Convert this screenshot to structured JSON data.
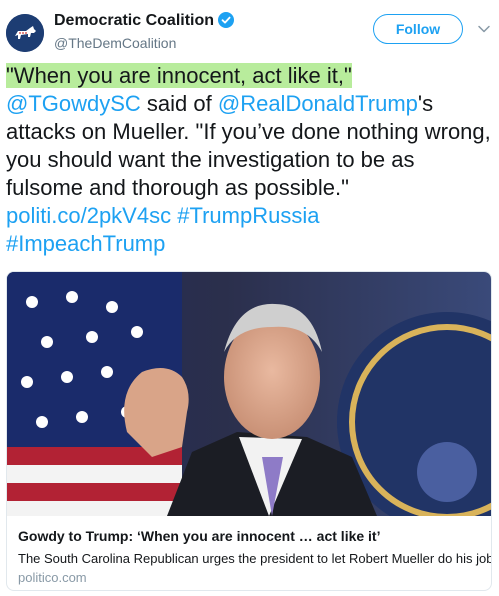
{
  "header": {
    "display_name": "Democratic Coalition",
    "handle": "@TheDemCoalition",
    "follow_label": "Follow"
  },
  "tweet": {
    "quote": "\"When you are innocent, act like it,\"",
    "mention1": "@TGowdySC",
    "text1": " said of ",
    "mention2": "@RealDonaldTrump",
    "text2": "'s attacks on Mueller. \"If you’ve done nothing wrong, you should want the investigation to be as fulsome and thorough as possible.\" ",
    "link": "politi.co/2pkV4sc",
    "space": " ",
    "hashtag1": "#TrumpRussia",
    "hashtag2": "#ImpeachTrump"
  },
  "card": {
    "title": "Gowdy to Trump: ‘When you are innocent … act like it’",
    "description": "The South Carolina Republican urges the president to let Robert Mueller do his job.",
    "domain": "politico.com"
  },
  "colors": {
    "accent": "#1da1f2",
    "highlight": "#b8ec9c",
    "text": "#14171a",
    "secondary": "#657786"
  }
}
